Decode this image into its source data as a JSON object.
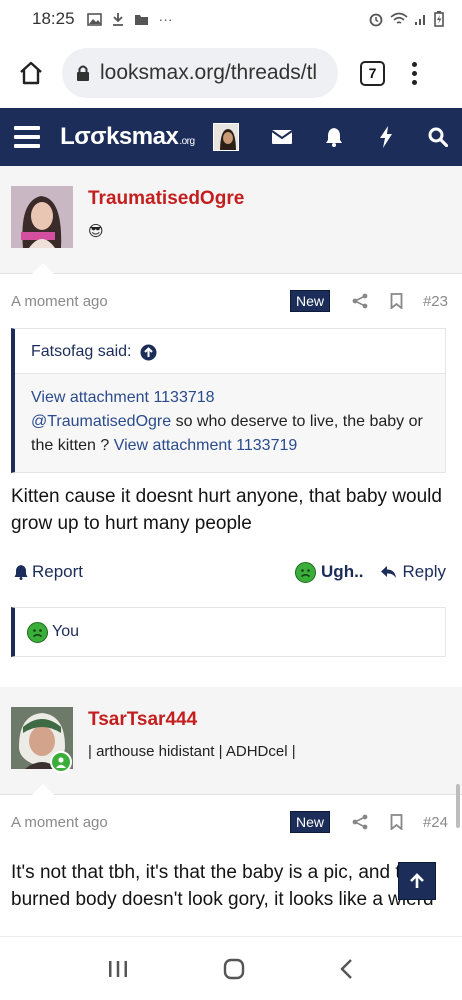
{
  "status_bar": {
    "time": "18:25",
    "dots": "···"
  },
  "browser": {
    "url": "looksmax.org/threads/tl",
    "tab_count": "7"
  },
  "site": {
    "logo_main": "Lσσksmax",
    "logo_suffix": ".org"
  },
  "posts": [
    {
      "username": "TraumatisedOgre",
      "user_title": "😎",
      "time": "A moment ago",
      "badge": "New",
      "number": "#23",
      "quote": {
        "author": "Fatsofag said:",
        "line1_link": "View attachment 1133718",
        "mention": "@TraumatisedOgre",
        "text": " so who deserve to live, the baby or the kitten ? ",
        "line3_link": "View attachment 1133719"
      },
      "body": "Kitten cause it doesnt hurt anyone, that baby would grow up to hurt many people",
      "actions": {
        "report": "Report",
        "reaction": "Ugh..",
        "reply": "Reply"
      },
      "reactions_by": "You"
    },
    {
      "username": "TsarTsar444",
      "user_title": "| arthouse hidistant | ADHDcel |",
      "time": "A moment ago",
      "badge": "New",
      "number": "#24",
      "body": "It's not that tbh, it's that the baby is a pic, and the burned body doesn't look gory, it looks like a wierd"
    }
  ],
  "colors": {
    "brand_navy": "#1c2d59",
    "username_red": "#c41e1e",
    "reaction_green": "#3bad3b"
  }
}
